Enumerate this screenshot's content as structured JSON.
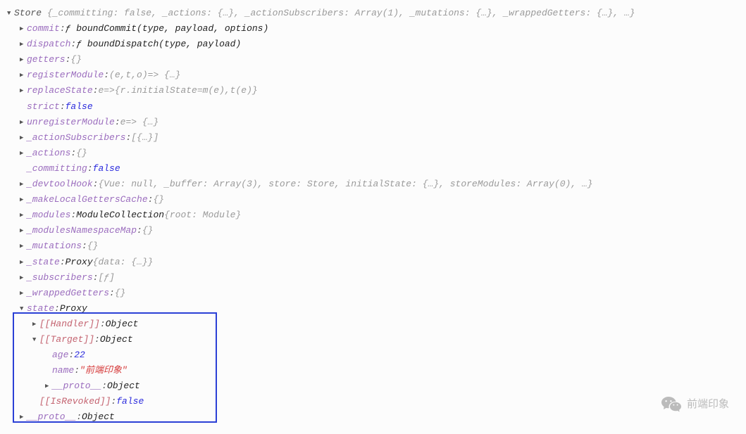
{
  "store": {
    "header": {
      "name": "Store",
      "preview": "{_committing: false, _actions: {…}, _actionSubscribers: Array(1), _mutations: {…}, _wrappedGetters: {…}, …}"
    },
    "props": [
      {
        "key": "commit",
        "kind": "fn",
        "val": "ƒ boundCommit(type, payload, options)"
      },
      {
        "key": "dispatch",
        "kind": "fn",
        "val": "ƒ boundDispatch(type, payload)"
      },
      {
        "key": "getters",
        "kind": "obj",
        "val": "{}"
      },
      {
        "key": "registerModule",
        "kind": "arrow",
        "val": "(e,t,o)=> {…}"
      },
      {
        "key": "replaceState",
        "kind": "arrow",
        "val": "e=>{r.initialState=m(e),t(e)}"
      },
      {
        "key": "strict",
        "kind": "bool-noexpand",
        "val": "false"
      },
      {
        "key": "unregisterModule",
        "kind": "arrow",
        "val": "e=> {…}"
      },
      {
        "key": "_actionSubscribers",
        "kind": "obj",
        "val": "[{…}]"
      },
      {
        "key": "_actions",
        "kind": "obj",
        "val": "{}"
      },
      {
        "key": "_committing",
        "kind": "bool-noexpand",
        "val": "false"
      },
      {
        "key": "_devtoolHook",
        "kind": "obj",
        "val": "{Vue: null, _buffer: Array(3), store: Store, initialState: {…}, storeModules: Array(0), …}"
      },
      {
        "key": "_makeLocalGettersCache",
        "kind": "obj",
        "val": "{}"
      },
      {
        "key": "_modules",
        "kind": "obj-named",
        "name": "ModuleCollection",
        "val": "{root: Module}"
      },
      {
        "key": "_modulesNamespaceMap",
        "kind": "obj",
        "val": "{}"
      },
      {
        "key": "_mutations",
        "kind": "obj",
        "val": "{}"
      },
      {
        "key": "_state",
        "kind": "obj-named",
        "name": "Proxy",
        "val": "{data: {…}}"
      },
      {
        "key": "_subscribers",
        "kind": "obj",
        "val": "[ƒ]"
      },
      {
        "key": "_wrappedGetters",
        "kind": "obj",
        "val": "{}"
      }
    ],
    "state": {
      "key": "state",
      "proxy_name": "Proxy",
      "handler": {
        "key": "[[Handler]]",
        "val": "Object"
      },
      "target": {
        "key": "[[Target]]",
        "val": "Object",
        "children": {
          "age": {
            "key": "age",
            "val": "22"
          },
          "name": {
            "key": "name",
            "val": "\"前端印象\""
          },
          "proto": {
            "key": "__proto__",
            "val": "Object"
          }
        }
      },
      "isrevoked": {
        "key": "[[IsRevoked]]",
        "val": "false"
      }
    },
    "proto": {
      "key": "__proto__",
      "val": "Object"
    }
  },
  "watermark": "前端印象"
}
